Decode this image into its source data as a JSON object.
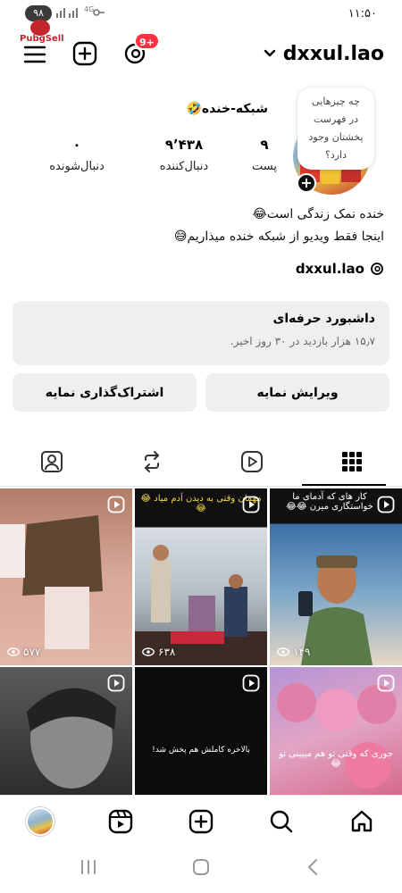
{
  "status_bar": {
    "battery": "۹۸",
    "time": "۱۱:۵۰",
    "network": "4G"
  },
  "watermark": {
    "text": "PubgSell"
  },
  "header": {
    "username": "dxxul.lao",
    "notification_count": "9+"
  },
  "profile": {
    "note": {
      "line1": "چه چیزهایی",
      "line2": "در فهرست",
      "line3": "پخشتان وجود",
      "line4": "دارد؟"
    },
    "display_name": "شبکه-خنده🤣",
    "stats": {
      "posts": {
        "value": "۹",
        "label": "پست"
      },
      "followers": {
        "value": "۹٬۴۳۸",
        "label": "دنبال‌کننده"
      },
      "following": {
        "value": "۰",
        "label": "دنبال‌شونده"
      }
    },
    "bio_line1": "خنده نمک زندگی است😂",
    "bio_line2": "اینجا فقط ویدیو از شبکه خنده میذاریم😅",
    "threads_handle": "dxxul.lao"
  },
  "dashboard": {
    "title": "داشبورد حرفه‌ای",
    "subtitle": "۱۵٫۷ هزار بازدید در ۳۰ روز اخیر."
  },
  "actions": {
    "edit": "ویرایش نمایه",
    "share": "اشتراک‌گذاری نمایه"
  },
  "tabs": [
    "grid-icon",
    "reels-icon",
    "reposts-icon",
    "tagged-icon"
  ],
  "grid": [
    {
      "views": "۱۴۹",
      "caption": "کار های که آدمای ما خواستگاری میرن 😂😂"
    },
    {
      "views": "۶۳۸",
      "caption": "مهمان وقتی به دیدن آدم میاد 😂😂"
    },
    {
      "views": "۵۷۷",
      "caption": ""
    },
    {
      "views": "",
      "caption": "جوری که وقتی تو هم میبینی تو😂"
    },
    {
      "views": "",
      "caption": "بالاخره کاملش هم پخش شد!"
    },
    {
      "views": "",
      "caption": ""
    }
  ],
  "colors": {
    "accent": "#ff3040",
    "surface": "#efefef"
  }
}
